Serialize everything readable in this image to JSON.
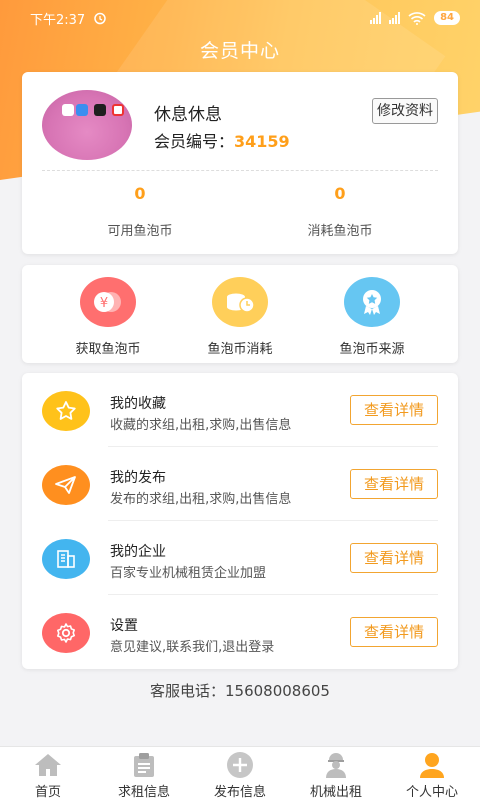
{
  "status_bar": {
    "time": "下午2:37",
    "battery": "84"
  },
  "header": {
    "title": "会员中心"
  },
  "profile": {
    "username": "休息休息",
    "member_label": "会员编号：",
    "member_number": "34159",
    "edit_label": "修改资料"
  },
  "stats": [
    {
      "value": "0",
      "label": "可用鱼泡币"
    },
    {
      "value": "0",
      "label": "消耗鱼泡币"
    }
  ],
  "coin_actions": [
    {
      "label": "获取鱼泡币",
      "icon": "yen-coins-icon",
      "color": "#ff6f6f"
    },
    {
      "label": "鱼泡币消耗",
      "icon": "coin-clock-icon",
      "color": "#ffcf5a"
    },
    {
      "label": "鱼泡币来源",
      "icon": "medal-icon",
      "color": "#66c6f2"
    }
  ],
  "menu": [
    {
      "title": "我的收藏",
      "subtitle": "收藏的求组,出租,求购,出售信息",
      "button": "查看详情",
      "icon": "star-icon",
      "color": "#ffc21a"
    },
    {
      "title": "我的发布",
      "subtitle": "发布的求组,出租,求购,出售信息",
      "button": "查看详情",
      "icon": "send-icon",
      "color": "#ff8f1f"
    },
    {
      "title": "我的企业",
      "subtitle": "百家专业机械租赁企业加盟",
      "button": "查看详情",
      "icon": "building-icon",
      "color": "#43b5ef"
    },
    {
      "title": "设置",
      "subtitle": "意见建议,联系我们,退出登录",
      "button": "查看详情",
      "icon": "gear-icon",
      "color": "#ff6767"
    }
  ],
  "service_phone": "客服电话：15608008605",
  "tabs": [
    {
      "label": "首页",
      "icon": "home-icon"
    },
    {
      "label": "求租信息",
      "icon": "clipboard-icon"
    },
    {
      "label": "发布信息",
      "icon": "plus-circle-icon"
    },
    {
      "label": "机械出租",
      "icon": "worker-icon"
    },
    {
      "label": "个人中心",
      "icon": "person-icon",
      "active": true
    }
  ],
  "colors": {
    "accent": "#ff9f1a",
    "header_gradient_start": "#ff9a3c",
    "header_gradient_end": "#ffd36a"
  }
}
